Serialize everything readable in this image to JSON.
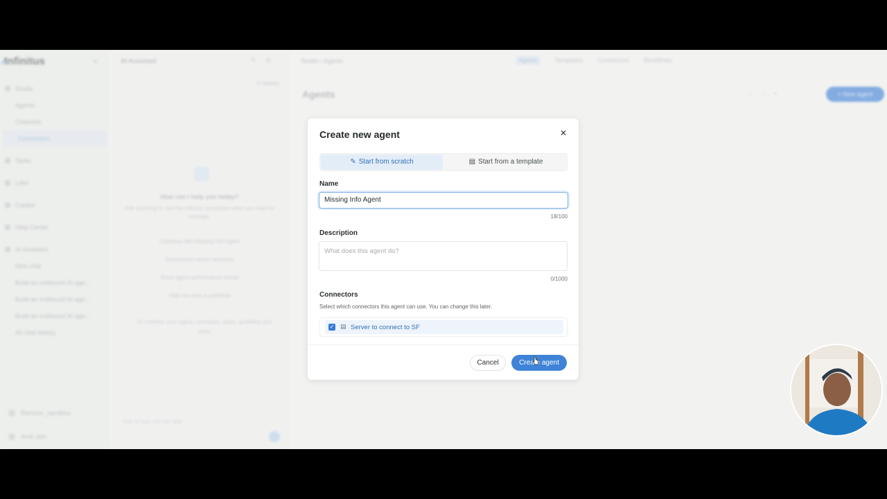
{
  "app": {
    "logo_text": "Infinitus",
    "sidebar": {
      "items": [
        {
          "label": "Studio",
          "type": "group"
        },
        {
          "label": "Agents",
          "type": "sub"
        },
        {
          "label": "Channels",
          "type": "sub"
        },
        {
          "label": "Connectors",
          "type": "sub-active"
        },
        {
          "label": "Tasks",
          "type": "group"
        },
        {
          "label": "Labs",
          "type": "group"
        },
        {
          "label": "Copilot",
          "type": "group"
        },
        {
          "label": "Help Center",
          "type": "group"
        },
        {
          "label": "AI Assistant",
          "type": "group"
        },
        {
          "label": "New chat",
          "type": "sub"
        },
        {
          "label": "Build an outbound AI age...",
          "type": "sub"
        },
        {
          "label": "Build an outbound AI age...",
          "type": "sub"
        },
        {
          "label": "Build an outbound AI age...",
          "type": "sub"
        },
        {
          "label": "All chat history",
          "type": "sub"
        }
      ],
      "footer_items": [
        "Remmic_sandbox",
        "Amit Jain"
      ]
    },
    "assistant": {
      "title": "AI Assistant",
      "history_label": "History",
      "heading": "How can I help you today?",
      "subtext": "Ask anything or visit the Infinitus templates when you want to manage.",
      "suggestions": [
        "Continue with Missing Info Agent",
        "Summarize recent sessions",
        "Show agent performance trends",
        "Help me write a guideline"
      ],
      "note": "Or mention your agent, connector, tasks, guideline and more",
      "input_placeholder": "Ask AI how can we help"
    },
    "topbar": {
      "breadcrumb": "Studio / Agents",
      "tabs": [
        {
          "label": "Agents",
          "active": true
        },
        {
          "label": "Templates",
          "active": false
        },
        {
          "label": "Connectors",
          "active": false
        },
        {
          "label": "Workflows",
          "active": false
        }
      ]
    },
    "page_title": "Agents",
    "new_agent_label": "+ New agent"
  },
  "modal": {
    "title": "Create new agent",
    "close_icon": "close-icon",
    "mode_tabs": {
      "scratch_label": "Start from scratch",
      "template_label": "Start from a template",
      "active": "scratch"
    },
    "name": {
      "label": "Name",
      "value": "Missing Info Agent",
      "counter": "18/100"
    },
    "description": {
      "label": "Description",
      "placeholder": "What does this agent do?",
      "counter": "0/1000"
    },
    "connectors": {
      "label": "Connectors",
      "help": "Select which connectors this agent can use. You can change this later.",
      "items": [
        {
          "label": "Server to connect to SF",
          "checked": true
        }
      ]
    },
    "cancel_label": "Cancel",
    "create_label": "Create agent"
  },
  "colors": {
    "accent": "#3f83d8",
    "accent_light": "#e3edf8"
  }
}
